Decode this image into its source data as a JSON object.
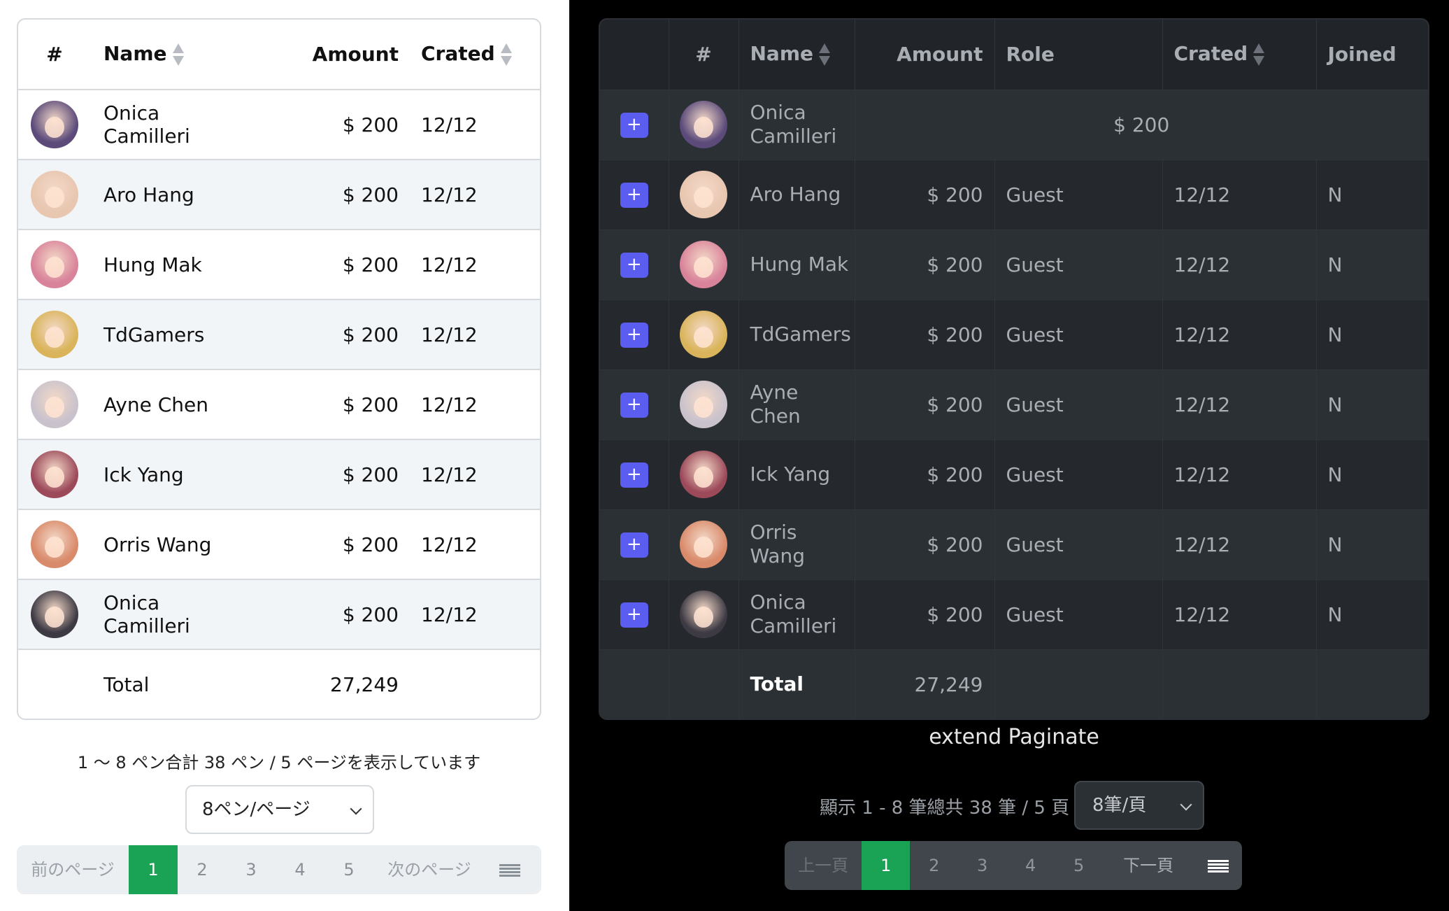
{
  "left": {
    "columns": {
      "index": "#",
      "name": "Name",
      "amount": "Amount",
      "created": "Crated"
    },
    "rows": [
      {
        "name": "Onica Camilleri",
        "amount": "$ 200",
        "created": "12/12",
        "avatar_color": "#5b4a7a"
      },
      {
        "name": "Aro Hang",
        "amount": "$ 200",
        "created": "12/12",
        "avatar_color": "#e8c6b0"
      },
      {
        "name": "Hung Mak",
        "amount": "$ 200",
        "created": "12/12",
        "avatar_color": "#d9839a"
      },
      {
        "name": "TdGamers",
        "amount": "$ 200",
        "created": "12/12",
        "avatar_color": "#d9b45a"
      },
      {
        "name": "Ayne Chen",
        "amount": "$ 200",
        "created": "12/12",
        "avatar_color": "#c9c2cc"
      },
      {
        "name": "Ick Yang",
        "amount": "$ 200",
        "created": "12/12",
        "avatar_color": "#9c4a5a"
      },
      {
        "name": "Orris Wang",
        "amount": "$ 200",
        "created": "12/12",
        "avatar_color": "#d98a6a"
      },
      {
        "name": "Onica Camilleri",
        "amount": "$ 200",
        "created": "12/12",
        "avatar_color": "#3e3a44"
      }
    ],
    "footer": {
      "label": "Total",
      "value": "27,249"
    },
    "info": "1 ～ 8 ペン合計 38 ペン / 5 ページを表示しています",
    "page_size": "8ペン/ページ",
    "pager": {
      "prev": "前のページ",
      "pages": [
        "1",
        "2",
        "3",
        "4",
        "5"
      ],
      "next": "次のページ",
      "active": "1"
    }
  },
  "right": {
    "columns": {
      "expand": "",
      "index": "#",
      "name": "Name",
      "amount": "Amount",
      "role": "Role",
      "created": "Crated",
      "joined": "Joined"
    },
    "expand_label": "+",
    "rows": [
      {
        "name": "Onica Camilleri",
        "amount": "$ 200",
        "role": "",
        "created": "",
        "joined": "",
        "merged": true,
        "avatar_color": "#5b4a7a"
      },
      {
        "name": "Aro Hang",
        "amount": "$ 200",
        "role": "Guest",
        "created": "12/12",
        "joined": "N",
        "avatar_color": "#e8c6b0"
      },
      {
        "name": "Hung Mak",
        "amount": "$ 200",
        "role": "Guest",
        "created": "12/12",
        "joined": "N",
        "avatar_color": "#d9839a"
      },
      {
        "name": "TdGamers",
        "amount": "$ 200",
        "role": "Guest",
        "created": "12/12",
        "joined": "N",
        "avatar_color": "#d9b45a"
      },
      {
        "name": "Ayne Chen",
        "amount": "$ 200",
        "role": "Guest",
        "created": "12/12",
        "joined": "N",
        "avatar_color": "#c9c2cc"
      },
      {
        "name": "Ick Yang",
        "amount": "$ 200",
        "role": "Guest",
        "created": "12/12",
        "joined": "N",
        "avatar_color": "#9c4a5a"
      },
      {
        "name": "Orris Wang",
        "amount": "$ 200",
        "role": "Guest",
        "created": "12/12",
        "joined": "N",
        "avatar_color": "#d98a6a"
      },
      {
        "name": "Onica Camilleri",
        "amount": "$ 200",
        "role": "Guest",
        "created": "12/12",
        "joined": "N",
        "avatar_color": "#3e3a44"
      }
    ],
    "footer": {
      "label": "Total",
      "value": "27,249"
    },
    "caption": "extend Paginate",
    "info": "顯示 1 - 8 筆總共 38 筆 / 5 頁",
    "page_size": "8筆/頁",
    "pager": {
      "prev": "上一頁",
      "pages": [
        "1",
        "2",
        "3",
        "4",
        "5"
      ],
      "next": "下一頁",
      "active": "1"
    }
  },
  "colors": {
    "active_page": "#1aa355",
    "expand_button": "#5b5cf0"
  }
}
